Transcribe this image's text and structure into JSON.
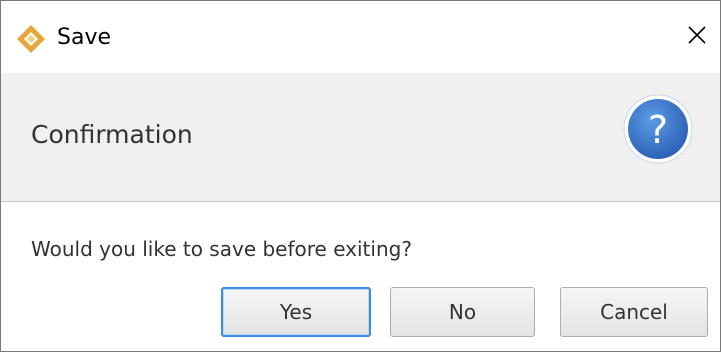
{
  "window": {
    "title": "Save",
    "app_icon": "diamond-logo-icon",
    "close_icon": "close-icon"
  },
  "header": {
    "text": "Confirmation",
    "icon": "question-mark-icon"
  },
  "content": {
    "message": "Would you like to save before exiting?"
  },
  "buttons": {
    "yes": "Yes",
    "no": "No",
    "cancel": "Cancel",
    "default": "yes"
  },
  "colors": {
    "logo_primary": "#e8a63a",
    "logo_secondary": "#f3cf7a",
    "help_icon_fill": "#2f6fc7",
    "default_button_border": "#3c8ddc"
  }
}
